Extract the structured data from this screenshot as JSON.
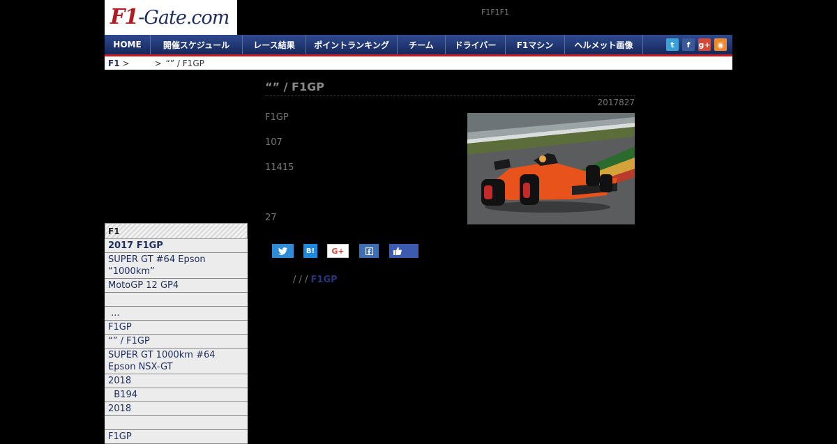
{
  "logo": {
    "part1": "F1",
    "part2": "-Gate.com"
  },
  "tagline": "F1F1F1",
  "nav": {
    "items": [
      "HOME",
      "開催スケジュール",
      "レース結果",
      "ポイントランキング",
      "チーム",
      "ドライバー",
      "F1マシン",
      "ヘルメット画像"
    ],
    "social": [
      {
        "icon": "twitter-icon",
        "glyph": "t",
        "color": "#3aa0d8"
      },
      {
        "icon": "facebook-icon",
        "glyph": "f",
        "color": "#3b5998"
      },
      {
        "icon": "google-plus-icon",
        "glyph": "g+",
        "color": "#d34836"
      },
      {
        "icon": "rss-icon",
        "glyph": "◉",
        "color": "#ef8a2b"
      }
    ]
  },
  "breadcrumb": {
    "home": "F1",
    "sep1": ">",
    "sep2": ">",
    "current": "“” / F1GP"
  },
  "article": {
    "title": "“” / F1GP",
    "date": "2017827",
    "paragraphs": [
      "F1GP",
      "107",
      "11415",
      "27"
    ]
  },
  "share": {
    "hatena": "B!",
    "google": "G+"
  },
  "tags": {
    "sep": "/ / /",
    "link": "F1GP"
  },
  "sidebar": {
    "header": "F1",
    "items": [
      {
        "label": "2017 F1GP",
        "bold": true
      },
      {
        "label": "SUPER GT #64 Epson “1000km”"
      },
      {
        "label": "MotoGP 12 GP4"
      },
      {
        "label": ""
      },
      {
        "label": " ..."
      },
      {
        "label": "F1GP"
      },
      {
        "label": "“” / F1GP"
      },
      {
        "label": "SUPER GT 1000km #64 Epson NSX-GT"
      },
      {
        "label": "2018"
      },
      {
        "label": "  B194"
      },
      {
        "label": "2018"
      },
      {
        "label": ""
      },
      {
        "label": "F1GP"
      }
    ]
  },
  "colors": {
    "nav_blue": "#1f3470",
    "nav_red": "#c41a20",
    "link_blue": "#26357a"
  }
}
